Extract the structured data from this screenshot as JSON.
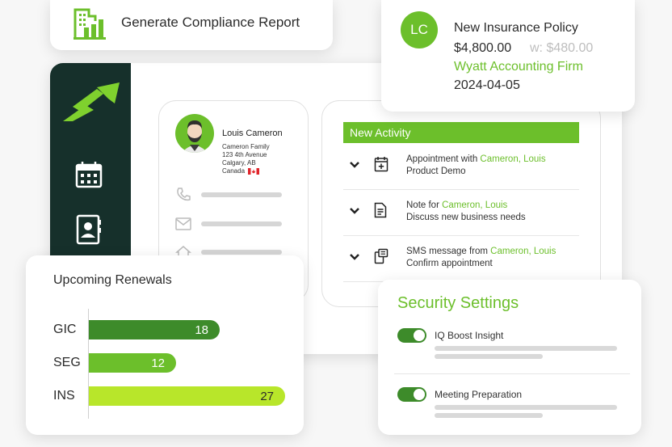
{
  "compliance": {
    "label": "Generate Compliance Report",
    "icon": "building-chart-icon"
  },
  "policy": {
    "initials": "LC",
    "title": "New Insurance Policy",
    "amount": "$4,800.00",
    "commission": "w: $480.00",
    "firm": "Wyatt Accounting Firm",
    "date": "2024-04-05"
  },
  "sidebar": {
    "items": [
      {
        "icon": "calendar-icon"
      },
      {
        "icon": "contact-book-icon"
      }
    ]
  },
  "contact": {
    "name": "Louis Cameron",
    "household": "Cameron Family",
    "street": "123 4th Avenue",
    "city": "Calgary, AB",
    "country": "Canada"
  },
  "activity": {
    "header": "New Activity",
    "items": [
      {
        "prefix": "Appointment with ",
        "person": "Cameron, Louis",
        "subtitle": "Product Demo",
        "icon": "calendar-plus-icon"
      },
      {
        "prefix": "Note for ",
        "person": "Cameron, Louis",
        "subtitle": "Discuss new business needs",
        "icon": "note-icon"
      },
      {
        "prefix": "SMS message from ",
        "person": "Cameron, Louis",
        "subtitle": "Confirm appointment",
        "icon": "sms-icon"
      }
    ]
  },
  "renewals": {
    "title": "Upcoming Renewals"
  },
  "chart_data": {
    "type": "bar",
    "orientation": "horizontal",
    "title": "Upcoming Renewals",
    "categories": [
      "GIC",
      "SEG",
      "INS"
    ],
    "values": [
      18,
      12,
      27
    ],
    "colors": [
      "#3d8b2a",
      "#6cbf2b",
      "#b8e62a"
    ],
    "xlim": [
      0,
      30
    ]
  },
  "security": {
    "title": "Security Settings",
    "settings": [
      {
        "label": "IQ Boost Insight",
        "enabled": true
      },
      {
        "label": "Meeting Preparation",
        "enabled": true
      }
    ]
  },
  "colors": {
    "brand_green": "#6cbf2b",
    "dark_green": "#3d8b2a",
    "lime": "#b8e62a",
    "sidebar": "#16302b"
  }
}
